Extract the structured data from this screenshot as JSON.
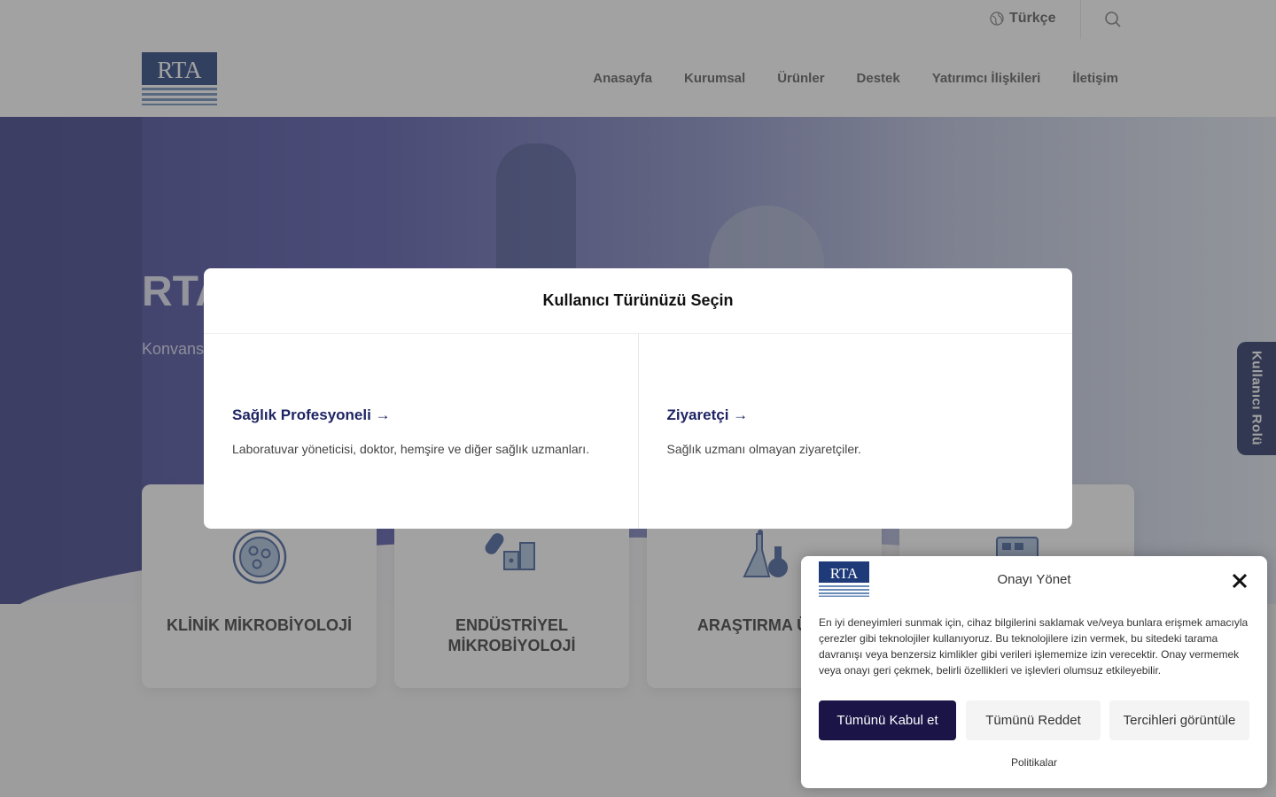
{
  "topbar": {
    "language": "Türkçe"
  },
  "header": {
    "logo_text": "RTA",
    "nav": [
      "Anasayfa",
      "Kurumsal",
      "Ürünler",
      "Destek",
      "Yatırımcı İlişkileri",
      "İletişim"
    ]
  },
  "hero": {
    "title": "RTA",
    "subtitle": "Konvans"
  },
  "categories": [
    {
      "label": "KLİNİK MİKROBİYOLOJİ",
      "icon": "petri-dish-icon"
    },
    {
      "label": "ENDÜSTRİYEL MİKROBİYOLOJİ",
      "icon": "food-products-icon"
    },
    {
      "label": "ARAŞTIRMA ÜRÜ",
      "icon": "lab-flask-icon"
    },
    {
      "label": "",
      "icon": "equipment-icon"
    }
  ],
  "side_tab": {
    "label": "Kullanıcı Rolü"
  },
  "modal": {
    "title": "Kullanıcı Türünüzü Seçin",
    "options": [
      {
        "title": "Sağlık Profesyoneli →",
        "description": "Laboratuvar yöneticisi, doktor, hemşire ve diğer sağlık uzmanları."
      },
      {
        "title": "Ziyaretçi →",
        "description": "Sağlık uzmanı olmayan ziyaretçiler."
      }
    ]
  },
  "cookie": {
    "logo_text": "RTA",
    "title": "Onayı Yönet",
    "text": "En iyi deneyimleri sunmak için, cihaz bilgilerini saklamak ve/veya bunlara erişmek amacıyla çerezler gibi teknolojiler kullanıyoruz. Bu teknolojilere izin vermek, bu sitedeki tarama davranışı veya benzersiz kimlikler gibi verileri işlememize izin verecektir. Onay vermemek veya onayı geri çekmek, belirli özellikleri ve işlevleri olumsuz etkileyebilir.",
    "accept_label": "Tümünü Kabul et",
    "reject_label": "Tümünü Reddet",
    "prefs_label": "Tercihleri görüntüle",
    "link_label": "Politikalar"
  },
  "colors": {
    "brand_navy": "#1e3a78",
    "accent_dark": "#1a1447",
    "link_blue": "#1f2563"
  }
}
